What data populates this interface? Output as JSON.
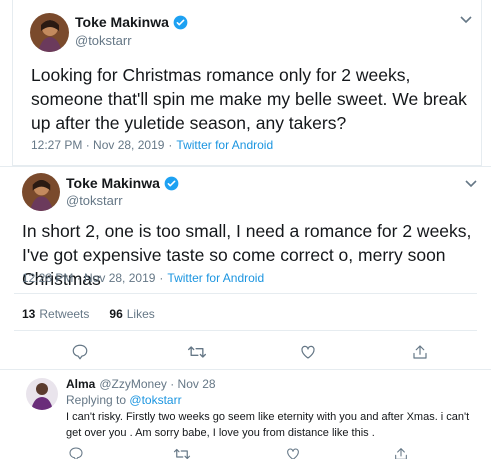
{
  "tweet1": {
    "name": "Toke Makinwa",
    "handle": "@tokstarr",
    "text": "Looking for Christmas romance only for 2 weeks, someone that'll spin me make my belle sweet. We break up after the yuletide season, any takers?",
    "time": "12:27 PM · Nov 28, 2019",
    "separator": "·",
    "source": "Twitter for Android"
  },
  "tweet2": {
    "name": "Toke Makinwa",
    "handle": "@tokstarr",
    "text": "In short 2, one is too small, I need a romance for 2 weeks, I've got expensive taste so come correct o, merry soon Christmas",
    "time": "12:28 PM · Nov 28, 2019",
    "separator": "·",
    "source": "Twitter for Android",
    "retweets_count": "13",
    "retweets_label": "Retweets",
    "likes_count": "96",
    "likes_label": "Likes"
  },
  "reply": {
    "name": "Alma",
    "handle": "@ZzyMoney · Nov 28",
    "replying_label": "Replying to",
    "replying_to": "@tokstarr",
    "text": "I can't risky. Firstly two weeks go seem like eternity with you and after Xmas. i can't get over you . Am sorry babe, I love you from distance like this ."
  },
  "icons": {
    "verified": "verified-badge-icon",
    "caret": "chevron-down-icon",
    "reply": "reply-icon",
    "retweet": "retweet-icon",
    "like": "heart-icon",
    "share": "share-icon"
  },
  "colors": {
    "accent": "#1b95e0",
    "muted": "#657786",
    "text": "#14171a",
    "border": "#e6ecf0"
  }
}
